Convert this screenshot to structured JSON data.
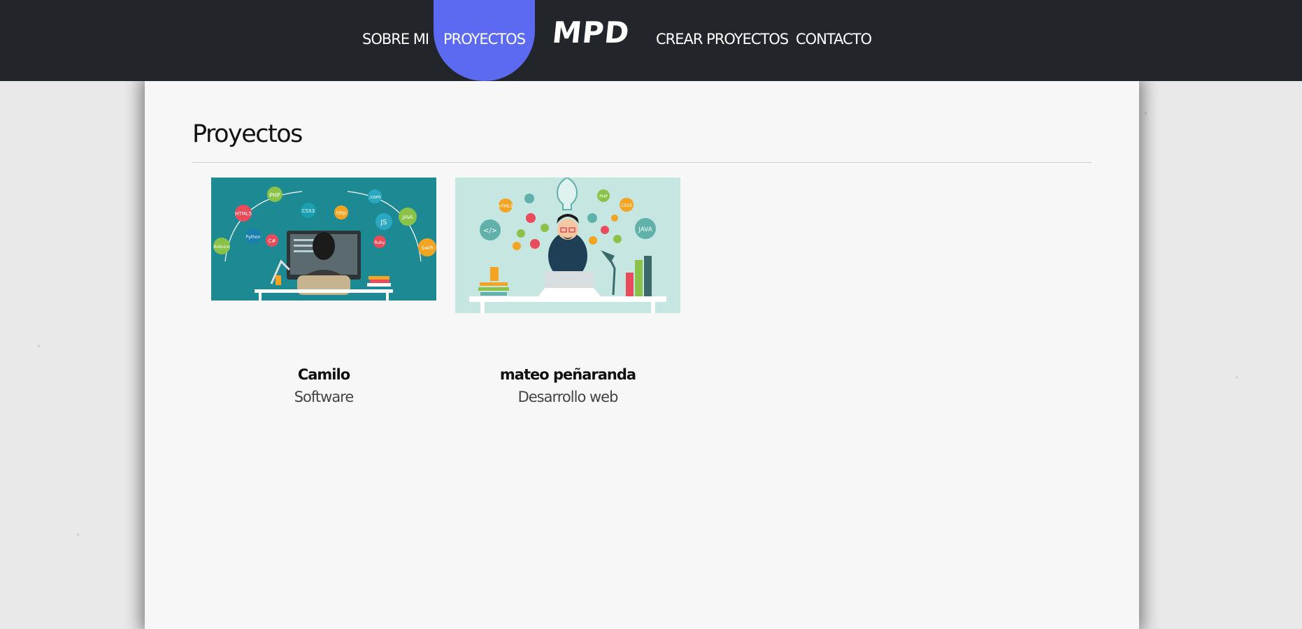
{
  "nav": {
    "items": [
      {
        "label": "SOBRE MI"
      },
      {
        "label": "PROYECTOS",
        "active": true
      },
      {
        "label": "CREAR PROYECTOS"
      },
      {
        "label": "CONTACTO"
      }
    ],
    "logo": "MPD",
    "accent_color": "#5b6af0",
    "bar_color": "#222529"
  },
  "main": {
    "title": "Proyectos",
    "projects": [
      {
        "name": "Camilo",
        "category": "Software",
        "image_tags": [
          "PHP",
          "HTML5",
          "CSS3",
          "http",
          ".com",
          "JS",
          "JAVA",
          "Ruby",
          "Python",
          "C#",
          "Arduino",
          "Swift"
        ]
      },
      {
        "name": "mateo peñaranda",
        "category": "Desarrollo web",
        "image_tags": [
          "HTML5",
          "PHP",
          "CSS3",
          "JAVA",
          "</>"
        ]
      }
    ]
  }
}
